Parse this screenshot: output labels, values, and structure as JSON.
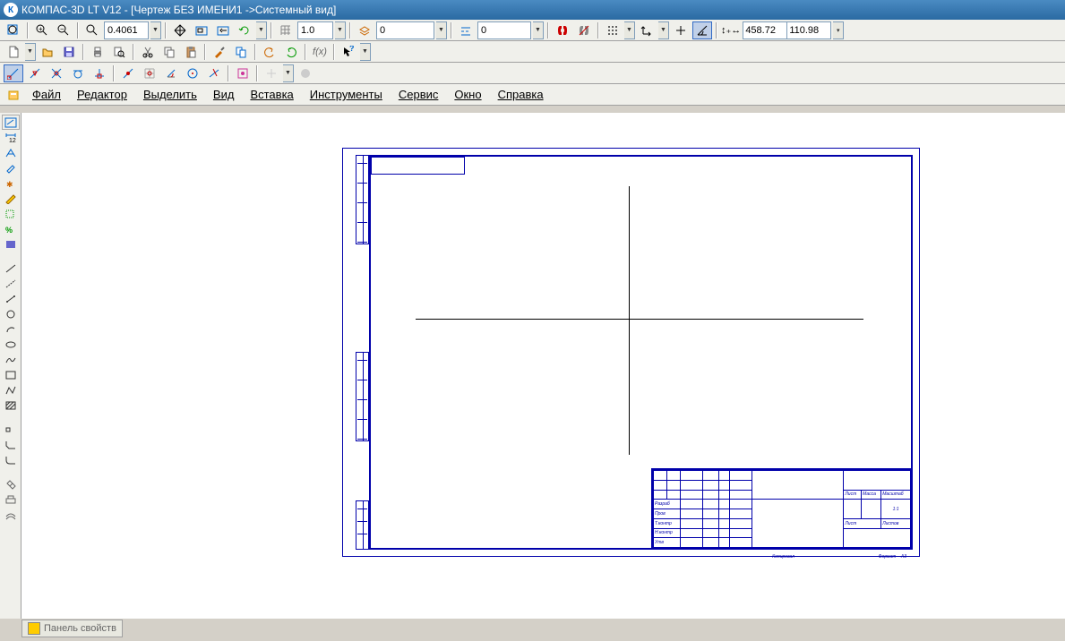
{
  "title": "КОМПАС-3D LT V12 - [Чертеж БЕЗ ИМЕНИ1 ->Системный вид]",
  "toolbar1": {
    "zoom_value": "0.4061",
    "scale_value": "1.0",
    "layer_value": "0",
    "style_value": "0",
    "coord_x": "458.72",
    "coord_y": "110.98"
  },
  "menu": {
    "file": "Файл",
    "edit": "Редактор",
    "select": "Выделить",
    "view": "Вид",
    "insert": "Вставка",
    "tools": "Инструменты",
    "service": "Сервис",
    "window": "Окно",
    "help": "Справка"
  },
  "bottom_panel": "Панель свойств",
  "title_block": {
    "scale_label": "1:1",
    "sheet_label": "Лист",
    "mass_label": "Масса",
    "scale_col": "Масштаб",
    "format": "Формат",
    "format_val": "А3"
  }
}
